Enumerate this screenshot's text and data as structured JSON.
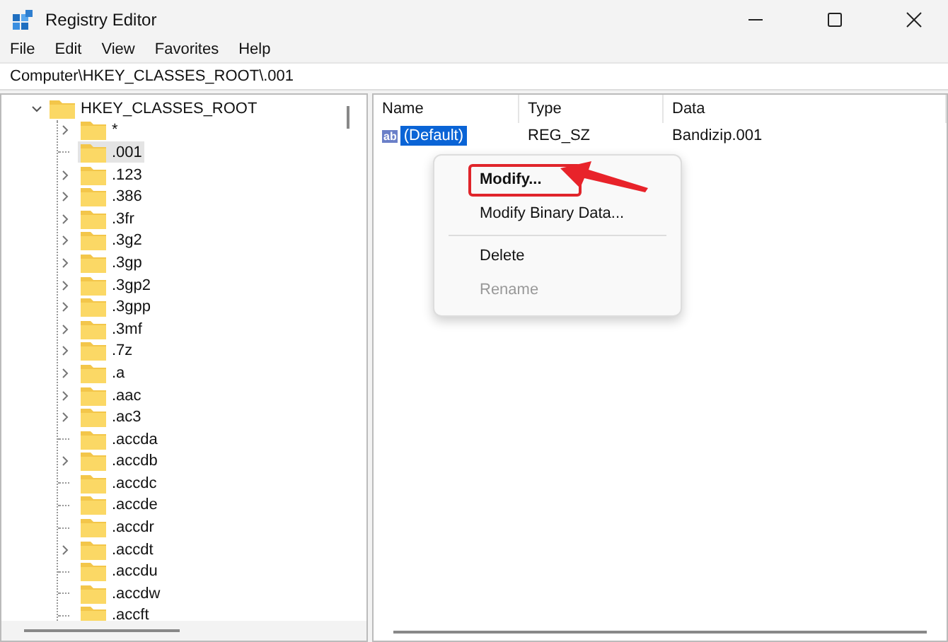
{
  "window": {
    "title": "Registry Editor"
  },
  "menu_bar": [
    "File",
    "Edit",
    "View",
    "Favorites",
    "Help"
  ],
  "address_bar": {
    "value": "Computer\\HKEY_CLASSES_ROOT\\.001"
  },
  "tree": {
    "label": "HKEY_CLASSES_ROOT",
    "expanded": true,
    "children": [
      {
        "label": "*",
        "has_children": true,
        "selected": false
      },
      {
        "label": ".001",
        "has_children": false,
        "selected": true
      },
      {
        "label": ".123",
        "has_children": true,
        "selected": false
      },
      {
        "label": ".386",
        "has_children": true,
        "selected": false
      },
      {
        "label": ".3fr",
        "has_children": true,
        "selected": false
      },
      {
        "label": ".3g2",
        "has_children": true,
        "selected": false
      },
      {
        "label": ".3gp",
        "has_children": true,
        "selected": false
      },
      {
        "label": ".3gp2",
        "has_children": true,
        "selected": false
      },
      {
        "label": ".3gpp",
        "has_children": true,
        "selected": false
      },
      {
        "label": ".3mf",
        "has_children": true,
        "selected": false
      },
      {
        "label": ".7z",
        "has_children": true,
        "selected": false
      },
      {
        "label": ".a",
        "has_children": true,
        "selected": false
      },
      {
        "label": ".aac",
        "has_children": true,
        "selected": false
      },
      {
        "label": ".ac3",
        "has_children": true,
        "selected": false
      },
      {
        "label": ".accda",
        "has_children": false,
        "selected": false
      },
      {
        "label": ".accdb",
        "has_children": true,
        "selected": false
      },
      {
        "label": ".accdc",
        "has_children": false,
        "selected": false
      },
      {
        "label": ".accde",
        "has_children": false,
        "selected": false
      },
      {
        "label": ".accdr",
        "has_children": false,
        "selected": false
      },
      {
        "label": ".accdt",
        "has_children": true,
        "selected": false
      },
      {
        "label": ".accdu",
        "has_children": false,
        "selected": false
      },
      {
        "label": ".accdw",
        "has_children": false,
        "selected": false
      },
      {
        "label": ".accft",
        "has_children": false,
        "selected": false
      }
    ]
  },
  "values": {
    "columns": [
      "Name",
      "Type",
      "Data"
    ],
    "rows": [
      {
        "icon_text": "ab",
        "name": "(Default)",
        "type": "REG_SZ",
        "data": "Bandizip.001",
        "selected": true
      }
    ]
  },
  "context_menu": [
    {
      "kind": "item",
      "label": "Modify...",
      "default": true,
      "highlighted": true,
      "disabled": false
    },
    {
      "kind": "item",
      "label": "Modify Binary Data...",
      "default": false,
      "highlighted": false,
      "disabled": false
    },
    {
      "kind": "separator"
    },
    {
      "kind": "item",
      "label": "Delete",
      "default": false,
      "highlighted": false,
      "disabled": false
    },
    {
      "kind": "item",
      "label": "Rename",
      "default": false,
      "highlighted": false,
      "disabled": true
    }
  ]
}
